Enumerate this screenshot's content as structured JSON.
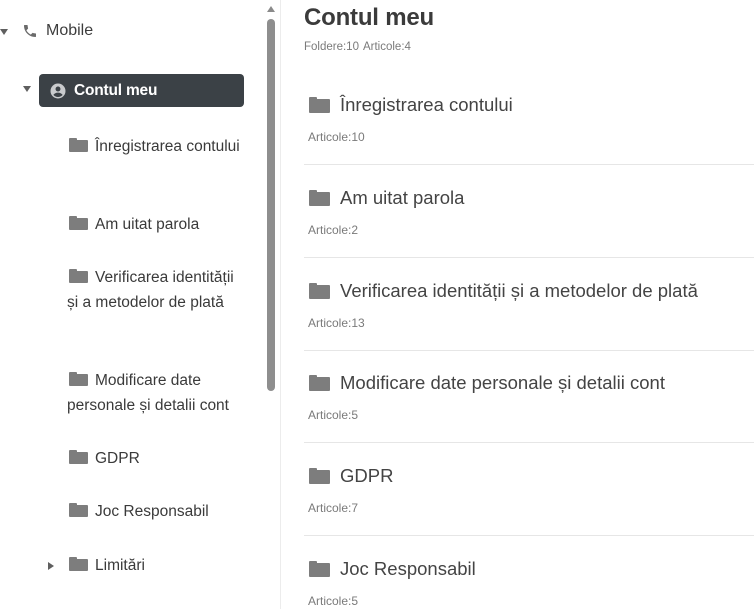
{
  "sidebar": {
    "root": {
      "label": "Mobile",
      "icon": "phone-icon",
      "expanded": true
    },
    "active": {
      "label": "Contul meu",
      "icon": "account-circle-icon",
      "expanded": true
    },
    "children": [
      {
        "label": "Înregistrarea contului"
      },
      {
        "label": "Am uitat parola"
      },
      {
        "label": "Verificarea identității și a metodelor de plată"
      },
      {
        "label": "Modificare date personale și detalii cont"
      },
      {
        "label": "GDPR"
      },
      {
        "label": "Joc Responsabil"
      },
      {
        "label": "Limitări",
        "collapsed": true
      }
    ]
  },
  "main": {
    "title": "Contul meu",
    "stats": {
      "folders": "Foldere:10",
      "articles": "Articole:4"
    },
    "cards": [
      {
        "title": "Înregistrarea contului",
        "count": "Articole:10"
      },
      {
        "title": "Am uitat parola",
        "count": "Articole:2"
      },
      {
        "title": "Verificarea identității și a metodelor de plată",
        "count": "Articole:13"
      },
      {
        "title": "Modificare date personale și detalii cont",
        "count": "Articole:5"
      },
      {
        "title": "GDPR",
        "count": "Articole:7"
      },
      {
        "title": "Joc Responsabil",
        "count": "Articole:5"
      }
    ]
  },
  "colors": {
    "active_bg": "#3b4146",
    "icon_gray": "#7d7d7d",
    "text": "#3c3c3c",
    "muted": "#7a7a7a"
  }
}
